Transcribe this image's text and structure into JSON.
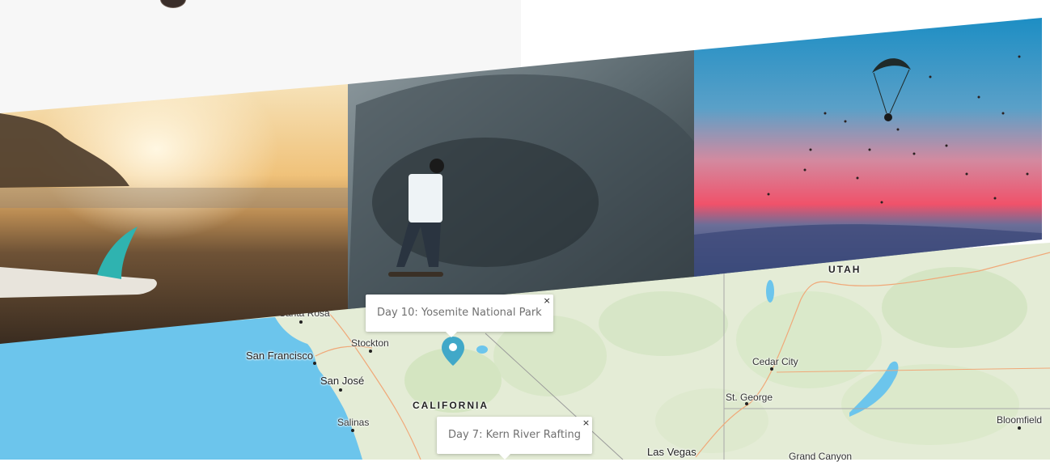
{
  "colors": {
    "ocean": "#6cc5ec",
    "land": "#e4ecd6",
    "marker": "#41a8c8",
    "panel": "#f7f7f7"
  },
  "map": {
    "states": [
      "UTAH",
      "CALIFORNIA"
    ],
    "cities": [
      {
        "name": "Santa Rosa"
      },
      {
        "name": "Stockton"
      },
      {
        "name": "San Francisco"
      },
      {
        "name": "San José"
      },
      {
        "name": "Salinas"
      },
      {
        "name": "Cedar City"
      },
      {
        "name": "St. George"
      },
      {
        "name": "Las Vegas"
      },
      {
        "name": "Grand Canyon"
      },
      {
        "name": "Bloomfield"
      }
    ],
    "popups": [
      {
        "label": "Day 10: Yosemite National Park",
        "close": "×"
      },
      {
        "label": "Day 7: Kern River Rafting",
        "close": "×"
      }
    ],
    "marker_icon": "map-pin-icon"
  },
  "gallery": {
    "photos": [
      {
        "alt": "Surfboard on beach at sunset"
      },
      {
        "alt": "Skater in concrete skatepark"
      },
      {
        "alt": "Paraglider over ocean at dusk"
      }
    ]
  }
}
